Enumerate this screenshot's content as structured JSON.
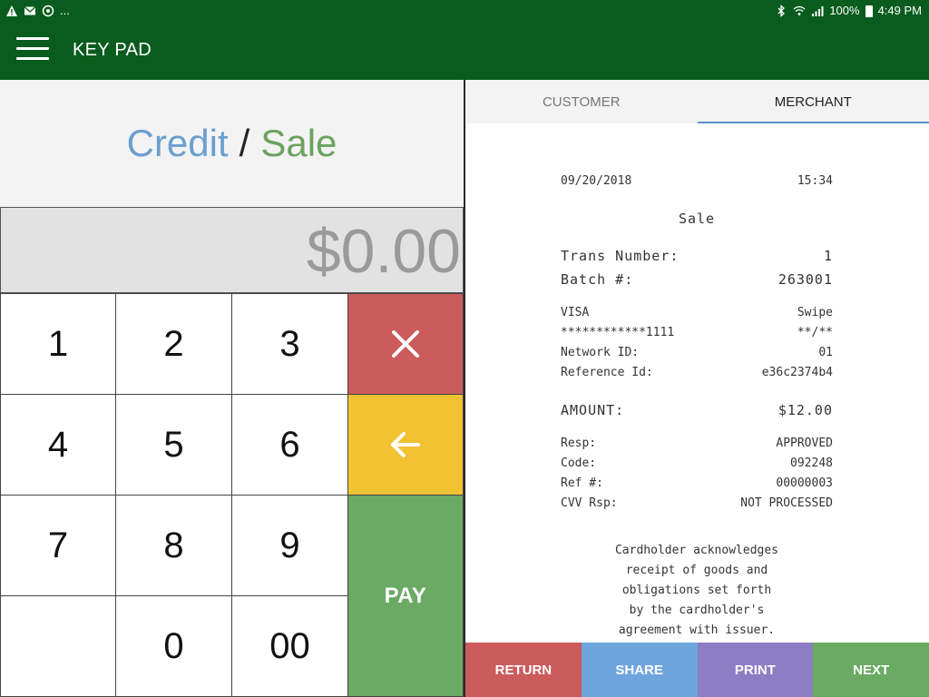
{
  "status_bar": {
    "left_icons": [
      "warning-icon",
      "mail-icon",
      "sync-icon"
    ],
    "more": "...",
    "battery_percent": "100%",
    "time": "4:49 PM"
  },
  "app_bar": {
    "title": "KEY PAD"
  },
  "transaction": {
    "type": "Credit",
    "separator": "/",
    "mode": "Sale",
    "amount": "$0.00"
  },
  "keypad": {
    "keys": [
      "1",
      "2",
      "3",
      "4",
      "5",
      "6",
      "7",
      "8",
      "9",
      "",
      "0",
      "00"
    ],
    "pay_label": "PAY"
  },
  "tabs": [
    {
      "label": "CUSTOMER",
      "active": false
    },
    {
      "label": "MERCHANT",
      "active": true
    }
  ],
  "receipt": {
    "date": "09/20/2018",
    "time": "15:34",
    "title": "Sale",
    "trans_number_label": "Trans Number:",
    "trans_number": "1",
    "batch_label": "Batch #:",
    "batch": "263001",
    "card_brand": "VISA",
    "entry_mode": "Swipe",
    "card_number": "************1111",
    "card_expiry": "**/**",
    "network_id_label": "Network ID:",
    "network_id": "01",
    "reference_id_label": "Reference Id:",
    "reference_id": "e36c2374b4",
    "amount_label": "AMOUNT:",
    "amount": "$12.00",
    "resp_label": "Resp:",
    "resp": "APPROVED",
    "code_label": "Code:",
    "code": "092248",
    "ref_label": "Ref #:",
    "ref": "00000003",
    "cvv_label": "CVV Rsp:",
    "cvv": "NOT PROCESSED",
    "disclaimer": [
      "Cardholder acknowledges",
      "receipt of goods and",
      "obligations set forth",
      "by the cardholder's",
      "agreement with issuer."
    ]
  },
  "actions": {
    "return": "RETURN",
    "share": "SHARE",
    "print": "PRINT",
    "next": "NEXT"
  },
  "colors": {
    "header_green": "#0a5c1e",
    "credit_blue": "#6a9fd0",
    "sale_green": "#6aa35f",
    "clear_red": "#cb5b5c",
    "backspace_yellow": "#f2c233",
    "pay_green": "#6aaa63",
    "share_blue": "#6ea5dd",
    "print_purple": "#8c7dc4"
  }
}
